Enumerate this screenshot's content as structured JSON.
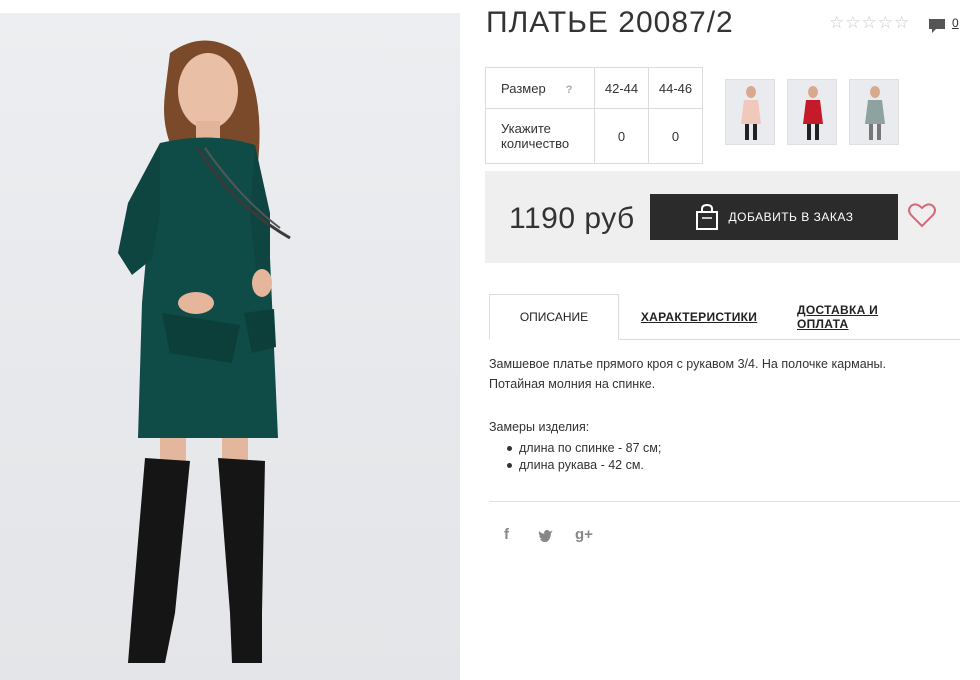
{
  "product": {
    "title": "ПЛАТЬЕ 20087/2",
    "rating_stars": 0,
    "comment_count": "0"
  },
  "size_table": {
    "size_label": "Размер",
    "help_icon": "?",
    "sizes": [
      "42-44",
      "44-46"
    ],
    "qty_label": "Укажите количество",
    "quantities": [
      "0",
      "0"
    ]
  },
  "thumbnails": [
    {
      "name": "thumb-pink-dress",
      "color": "#f0c8bc"
    },
    {
      "name": "thumb-red-dress",
      "color": "#c41a2a"
    },
    {
      "name": "thumb-grey-dress",
      "color": "#8ea3a0"
    }
  ],
  "price": {
    "value": "1190 руб",
    "order_button": "ДОБАВИТЬ В ЗАКАЗ"
  },
  "tabs": [
    {
      "label": "ОПИСАНИЕ",
      "active": true
    },
    {
      "label": "ХАРАКТЕРИСТИКИ",
      "active": false
    },
    {
      "label": "ДОСТАВКА И ОПЛАТА",
      "active": false
    }
  ],
  "description": {
    "line1": "Замшевое платье прямого кроя с рукавом 3/4. На полочке карманы.",
    "line2": "Потайная молния на спинке.",
    "measure_title": "Замеры изделия:",
    "measures": [
      "длина по спинке - 87 см;",
      "длина рукава - 42 см."
    ]
  },
  "social": {
    "facebook": "f",
    "twitter": "twitter-icon",
    "google": "g+"
  },
  "colors": {
    "dress": "#0f4b47",
    "button": "#2b2b2b",
    "heart": "#d36a7a"
  }
}
